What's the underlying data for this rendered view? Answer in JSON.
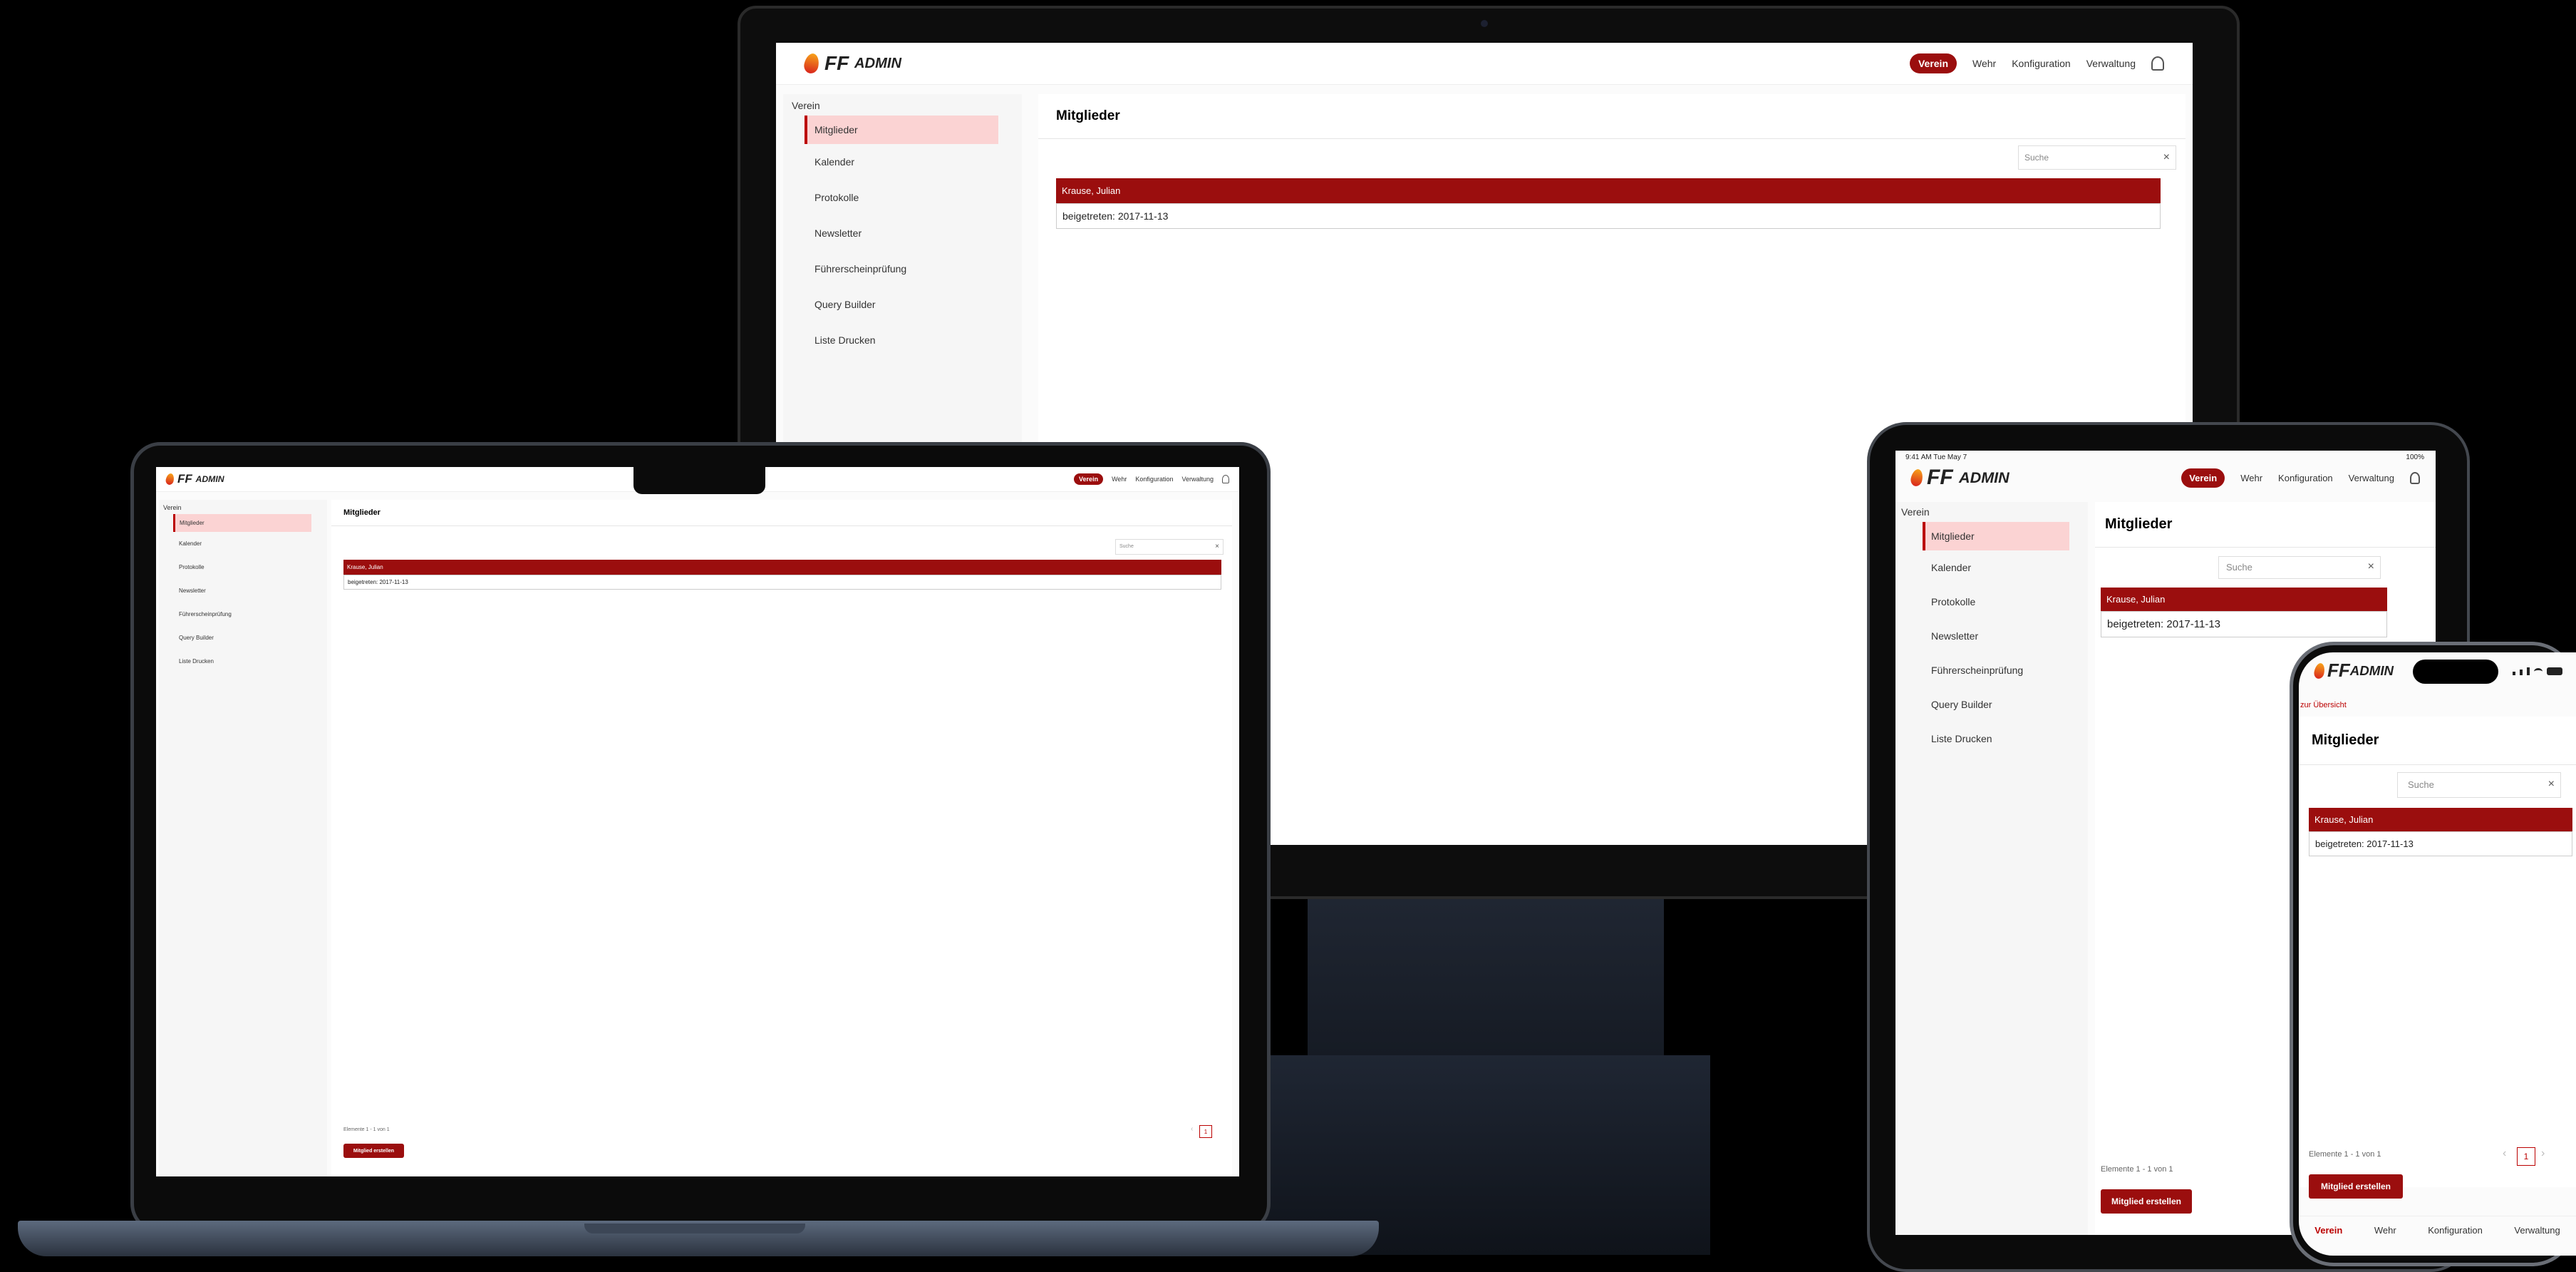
{
  "app": {
    "logo_ff": "FF",
    "logo_admin": "ADMIN"
  },
  "nav": {
    "active": "Verein",
    "items": [
      "Wehr",
      "Konfiguration",
      "Verwaltung"
    ]
  },
  "sidebar": {
    "section": "Verein",
    "items": [
      "Mitglieder",
      "Kalender",
      "Protokolle",
      "Newsletter",
      "Führerscheinprüfung",
      "Query Builder",
      "Liste Drucken"
    ]
  },
  "main": {
    "title": "Mitglieder",
    "search_placeholder": "Suche",
    "search_clear": "×",
    "member_name": "Krause, Julian",
    "member_joined": "beigetreten: 2017-11-13",
    "pagination_info": "Elemente 1 - 1 von 1",
    "page_number": "1",
    "prev": "‹",
    "next": "›",
    "create_button": "Mitglied erstellen",
    "back_link": "zur Übersicht"
  },
  "status_bar": {
    "time": "9:41 AM  Tue May 7",
    "battery": "100%"
  },
  "mobile_tabs": [
    "Verein",
    "Wehr",
    "Konfiguration",
    "Verwaltung"
  ],
  "colors": {
    "accent": "#9b0e0e",
    "active_bg": "#fbd3d3",
    "background": "#000000"
  }
}
